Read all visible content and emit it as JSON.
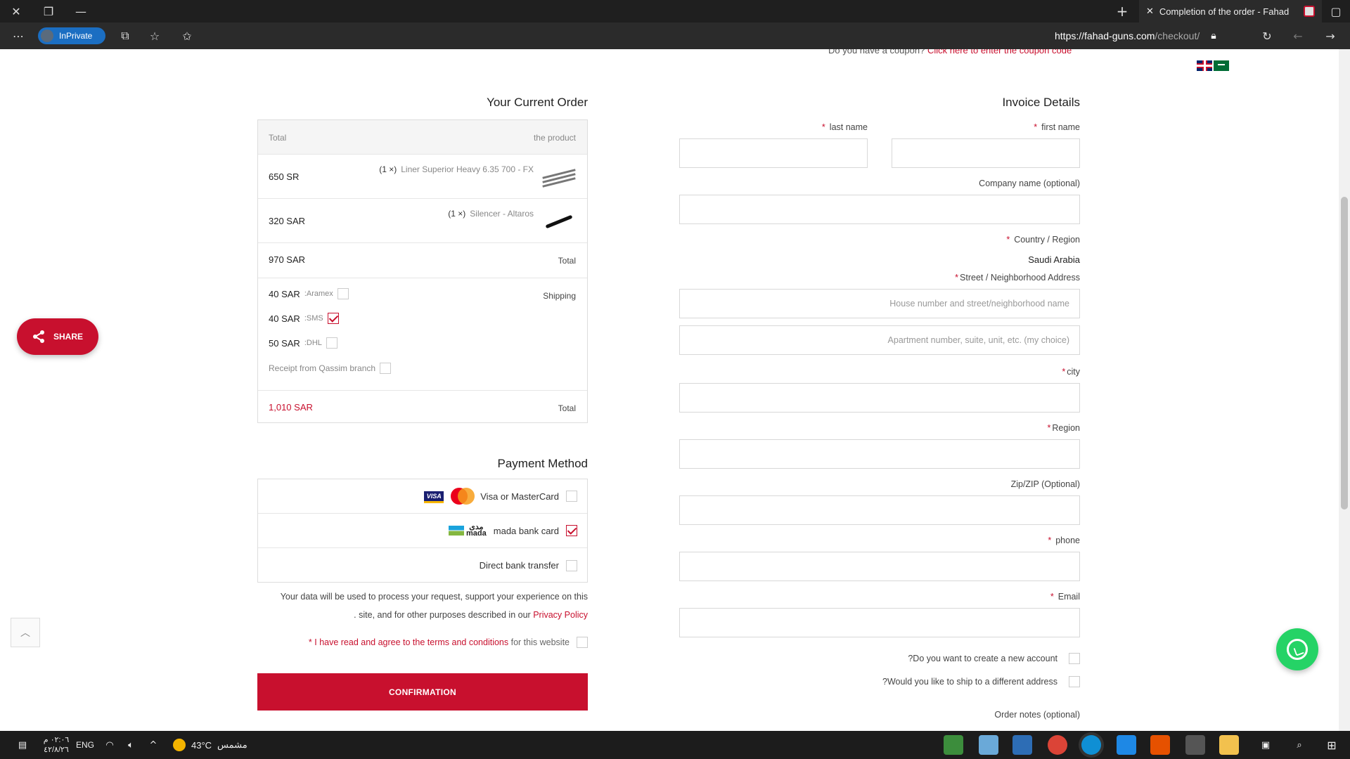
{
  "browser": {
    "tab_title": "Completion of the order - Fahad",
    "inprivate_label": "InPrivate",
    "url_host": "https://fahad-guns.com",
    "url_path": "/checkout/"
  },
  "coupon": {
    "question": "Do you have a coupon?",
    "link": "Click here to enter the coupon code"
  },
  "order": {
    "heading": "Your Current Order",
    "col_total": "Total",
    "col_product": "the product",
    "items": [
      {
        "price": "650 SR",
        "qty": "(1 ×)",
        "name": "Liner Superior Heavy 6.35 700 - FX"
      },
      {
        "price": "320 SAR",
        "qty": "(1 ×)",
        "name": "Silencer - Altaros"
      }
    ],
    "subtotal_value": "970 SAR",
    "subtotal_label": "Total",
    "shipping_label": "Shipping",
    "shipping_options": [
      {
        "price": "40 SAR",
        "carrier": ":Aramex",
        "checked": false
      },
      {
        "price": "40 SAR",
        "carrier": ":SMS",
        "checked": true
      },
      {
        "price": "50 SAR",
        "carrier": ":DHL",
        "checked": false
      },
      {
        "price": "",
        "carrier": "Receipt from Qassim branch",
        "checked": false
      }
    ],
    "total_value": "1,010 SAR",
    "total_label": "Total"
  },
  "payment": {
    "heading": "Payment Method",
    "methods": [
      {
        "label": "Visa or MasterCard",
        "checked": false
      },
      {
        "label": "mada bank card",
        "checked": true
      },
      {
        "label": "Direct bank transfer",
        "checked": false
      }
    ],
    "mada_logo_ar": "مدى",
    "mada_logo_en": "mada",
    "visa_logo": "VISA",
    "privacy_text_1": "Your data will be used to process your request, support your experience on this",
    "privacy_text_2": ". site, and for other purposes described in our",
    "privacy_link": "Privacy Policy",
    "agree_prefix": "* I have read and agree to the",
    "agree_link": "terms and conditions",
    "agree_suffix": "for this website",
    "confirm_label": "CONFIRMATION"
  },
  "invoice": {
    "heading": "Invoice Details",
    "last_name_label": "last name",
    "first_name_label": "first name",
    "company_label": "Company name (optional)",
    "country_label": "Country / Region",
    "country_value": "Saudi Arabia",
    "street_label": "Street / Neighborhood Address",
    "street_placeholder": "House number and street/neighborhood name",
    "apartment_placeholder": "Apartment number, suite, unit, etc. (my choice)",
    "city_label": "city",
    "region_label": "Region",
    "zip_label": "Zip/ZIP (Optional)",
    "phone_label": "phone",
    "email_label": "Email",
    "create_account_label": "?Do you want to create a new account",
    "ship_different_label": "?Would you like to ship to a different address",
    "order_notes_label": "Order notes (optional)",
    "required_mark": "*"
  },
  "widgets": {
    "share_label": "SHARE"
  },
  "taskbar": {
    "time": "٠٢:٠٦ م",
    "date": "٤٢/٨/٢٦",
    "lang": "ENG",
    "temperature": "43°C",
    "weather": "مشمس"
  },
  "colors": {
    "accent": "#c8102e",
    "whatsapp": "#25d366"
  }
}
